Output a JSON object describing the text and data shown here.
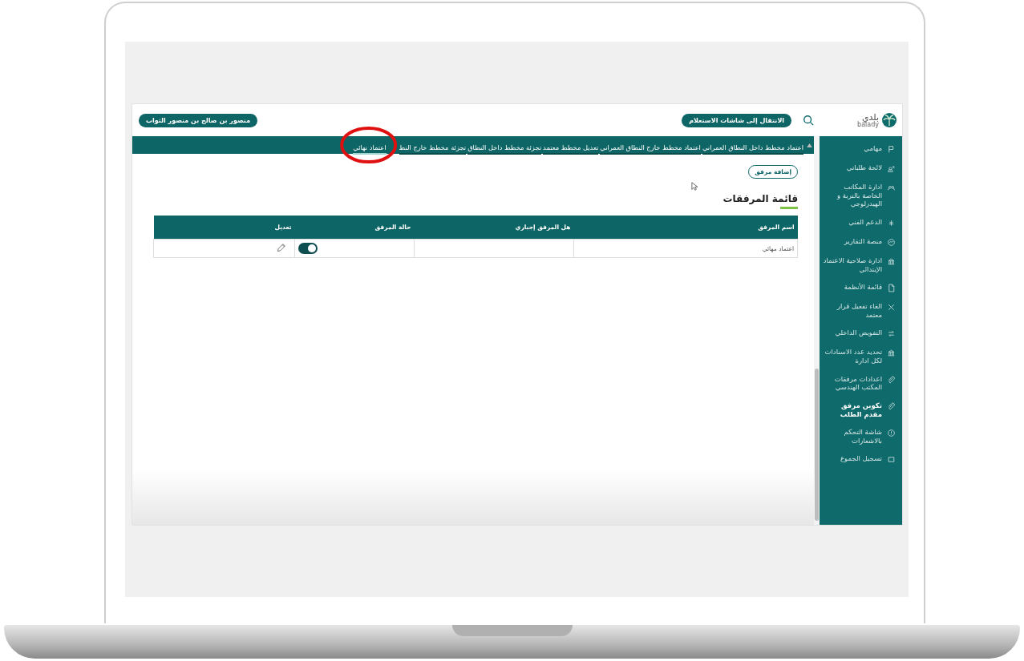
{
  "header": {
    "logo_arabic": "بلدي",
    "logo_latin": "balady",
    "inquiry_button": "الانتقال إلى شاشات الاستعلام",
    "user_button": "منصور بن صالح بن منصور الثواب"
  },
  "tabs": [
    {
      "label": "اعتماد مخطط داخل النطاق العمراني",
      "selected": false
    },
    {
      "label": "اعتماد مخطط خارج النطاق العمراني",
      "selected": false
    },
    {
      "label": "تعديل مخطط معتمد",
      "selected": false
    },
    {
      "label": "تجزئة مخطط داخل النطاق",
      "selected": false
    },
    {
      "label": "تجزئة مخطط خارج النط",
      "selected": false
    },
    {
      "label": "اعتماد نهائي",
      "selected": true
    }
  ],
  "add_button": "إضافة مرفق",
  "section_title": "قائمة المرفقات",
  "table": {
    "columns": [
      "اسم المرفق",
      "هل المرفق إجباري",
      "حالة المرفق",
      "تعديل"
    ],
    "rows": [
      {
        "name": "اعتماد مهائي",
        "status_on": true
      }
    ]
  },
  "sidebar": {
    "items": [
      {
        "label": "مهامي",
        "selected": false
      },
      {
        "label": "لائحة طلباتي",
        "selected": false
      },
      {
        "label": "ادارة المكاتب الخاصة بالتربة و الهيدرلوجي",
        "selected": false
      },
      {
        "label": "الدعم الفني",
        "selected": false
      },
      {
        "label": "منصة التقارير",
        "selected": false
      },
      {
        "label": "ادارة صلاحية الاعتماد الإبتدائي",
        "selected": false
      },
      {
        "label": "قائمة الأنظمة",
        "selected": false
      },
      {
        "label": "الغاء تفعيل قرار معتمد",
        "selected": false
      },
      {
        "label": "التفويض الداخلي",
        "selected": false
      },
      {
        "label": "تحديد عدد الاسنادات لكل ادارة",
        "selected": false
      },
      {
        "label": "اعدادات مرفقات المكتب الهندسي",
        "selected": false
      },
      {
        "label": "تكوين مرفق مقدم الطلب",
        "selected": true
      },
      {
        "label": "شاشة التحكم بالاشعارات",
        "selected": false
      },
      {
        "label": "تسجيل الجموع",
        "selected": false
      }
    ]
  }
}
